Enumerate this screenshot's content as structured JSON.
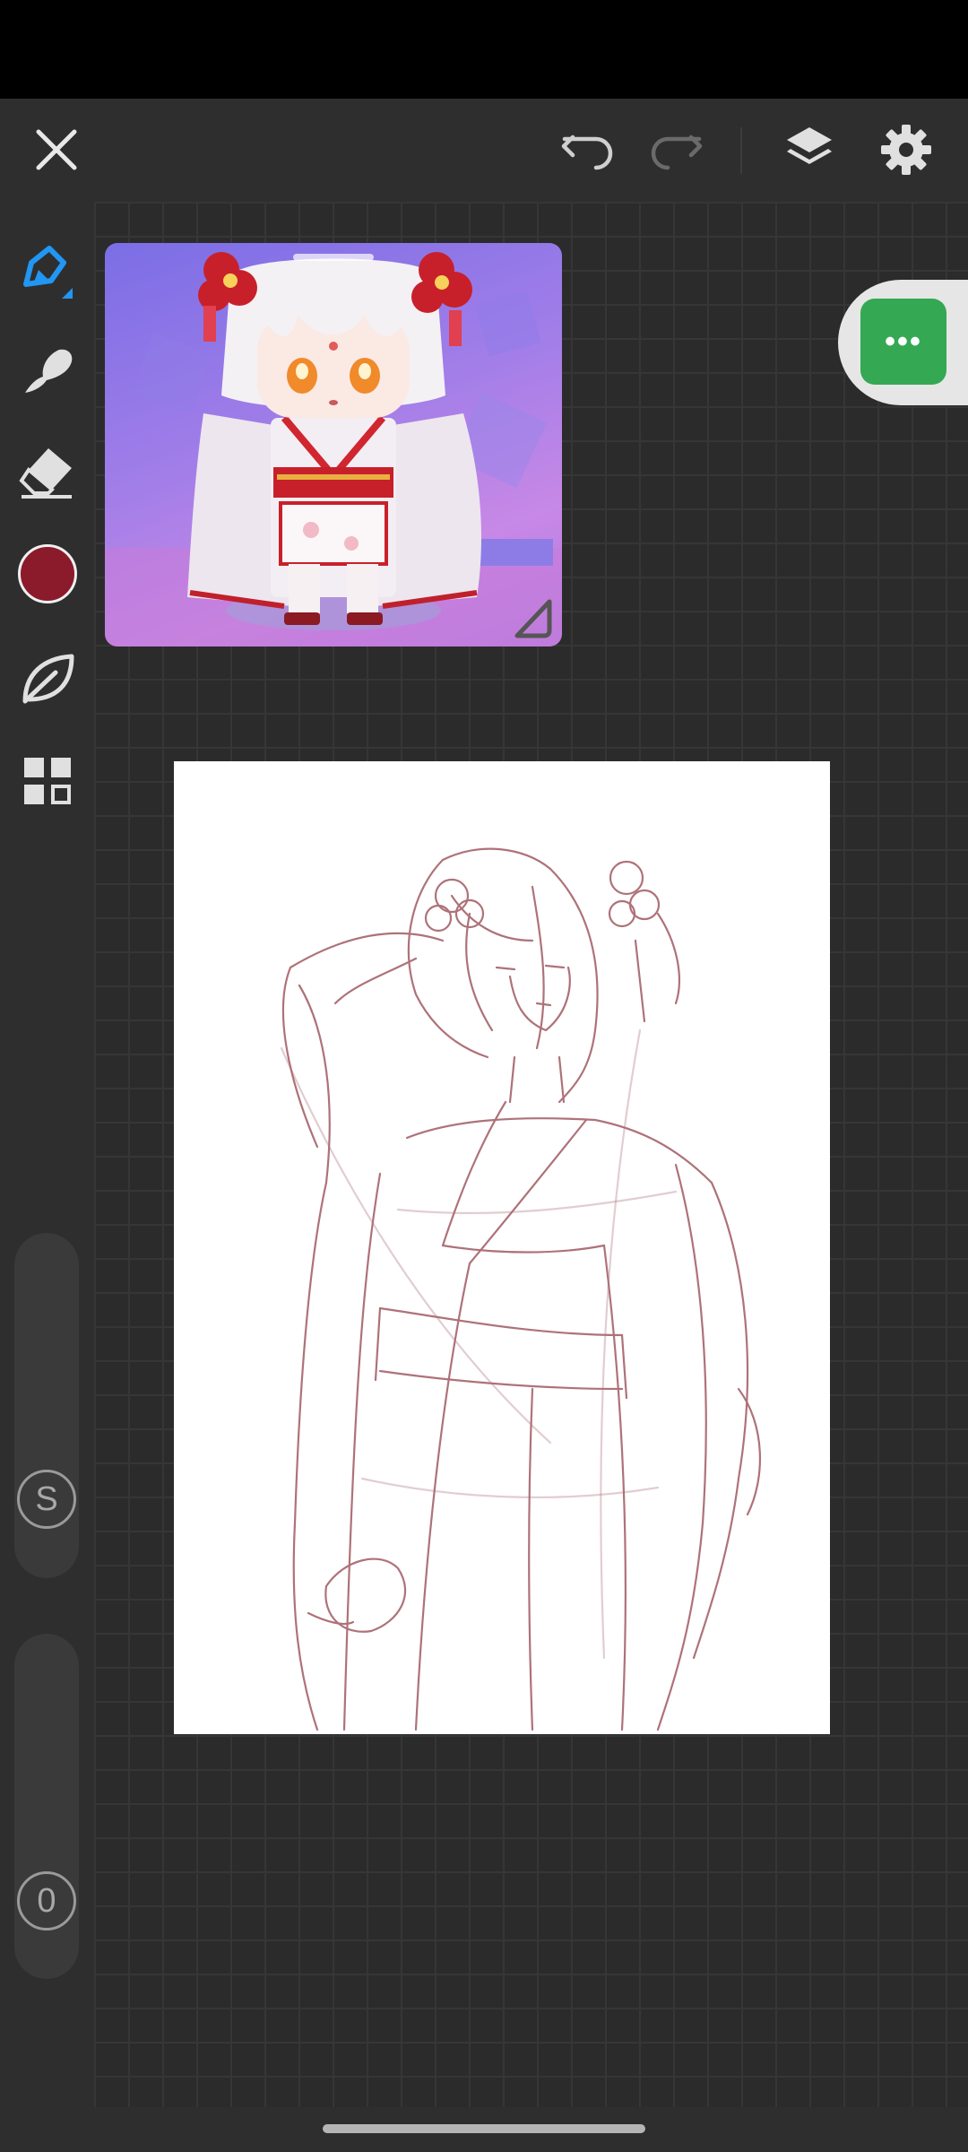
{
  "colors": {
    "accent": "#2196f3",
    "current_color": "#8b1a2b",
    "more_button": "#34a853",
    "sketch_stroke": "#a05a62"
  },
  "toolbar": {
    "close_icon": "close-icon",
    "undo_icon": "undo-icon",
    "redo_icon": "redo-icon",
    "layers_icon": "layers-icon",
    "settings_icon": "gear-icon"
  },
  "sidebar": {
    "tools": [
      "pencil",
      "brush",
      "eraser",
      "color",
      "leaf-brush",
      "grid"
    ],
    "size_slider_label": "S",
    "opacity_slider_label": "0"
  },
  "more_button_label": "•••"
}
